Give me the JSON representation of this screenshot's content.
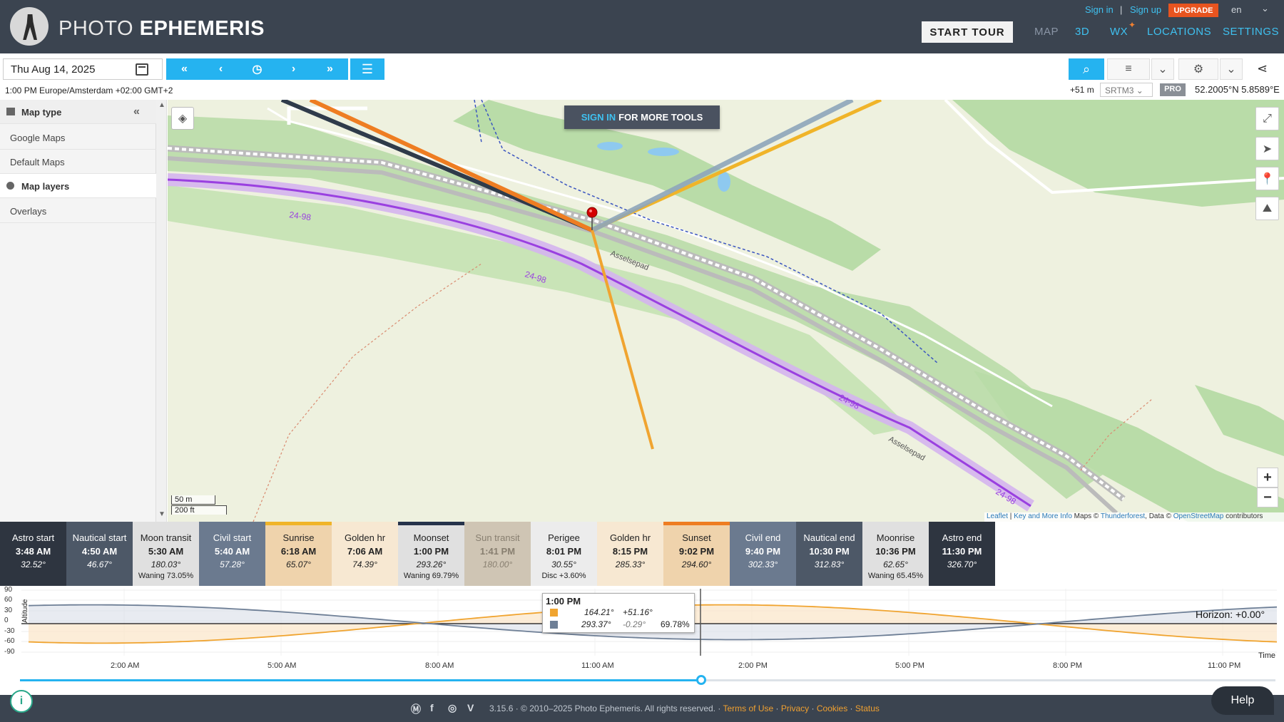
{
  "header": {
    "brand_light": "PHOTO",
    "brand_bold": "EPHEMERIS",
    "start_tour": "START TOUR",
    "nav": {
      "map": "MAP",
      "three_d": "3D",
      "wx": "WX",
      "locations": "LOCATIONS",
      "settings": "SETTINGS"
    },
    "sign_in": "Sign in",
    "separator": "|",
    "sign_up": "Sign up",
    "upgrade": "UPGRADE",
    "language": "en"
  },
  "toolbar": {
    "date": "Thu Aug 14, 2025",
    "timezone": "1:00 PM Europe/Amsterdam +02:00 GMT+2",
    "elevation": "+51 m",
    "dem": "SRTM3",
    "pro_badge": "PRO",
    "coordinates": "52.2005°N 5.8589°E"
  },
  "sidebar": {
    "map_type": "Map type",
    "items": [
      "Google Maps",
      "Default Maps"
    ],
    "map_layers": "Map layers",
    "overlays": "Overlays"
  },
  "map": {
    "signin_highlight": "SIGN IN",
    "signin_rest": "FOR MORE TOOLS",
    "scale_m": "50 m",
    "scale_ft": "200 ft",
    "labels": {
      "road": "Asselsepad",
      "route": "24-98"
    },
    "attribution": {
      "leaflet": "Leaflet",
      "key": "Key and More Info",
      "maps": " Maps © ",
      "thunderforest": "Thunderforest",
      "data": ", Data © ",
      "osm": "OpenStreetMap",
      "contrib": " contributors",
      "sep": " | "
    }
  },
  "events": [
    {
      "name": "Astro start",
      "time": "3:48 AM",
      "deg": "32.52°",
      "extra": "",
      "style": "night"
    },
    {
      "name": "Nautical start",
      "time": "4:50 AM",
      "deg": "46.67°",
      "extra": "",
      "style": "naut"
    },
    {
      "name": "Moon transit",
      "time": "5:30 AM",
      "deg": "180.03°",
      "extra": "Waning 73.05%",
      "style": "moon"
    },
    {
      "name": "Civil start",
      "time": "5:40 AM",
      "deg": "57.28°",
      "extra": "",
      "style": "civil"
    },
    {
      "name": "Sunrise",
      "time": "6:18 AM",
      "deg": "65.07°",
      "extra": "",
      "style": "sun top-yellow"
    },
    {
      "name": "Golden hr",
      "time": "7:06 AM",
      "deg": "74.39°",
      "extra": "",
      "style": "gold"
    },
    {
      "name": "Moonset",
      "time": "1:00 PM",
      "deg": "293.26°",
      "extra": "Waning 69.79%",
      "style": "moon top-dark"
    },
    {
      "name": "Sun transit",
      "time": "1:41 PM",
      "deg": "180.00°",
      "extra": "",
      "style": "transit"
    },
    {
      "name": "Perigee",
      "time": "8:01 PM",
      "deg": "30.55°",
      "extra": "Disc +3.60%",
      "style": "peri"
    },
    {
      "name": "Golden hr",
      "time": "8:15 PM",
      "deg": "285.33°",
      "extra": "",
      "style": "gold"
    },
    {
      "name": "Sunset",
      "time": "9:02 PM",
      "deg": "294.60°",
      "extra": "",
      "style": "sun top-orange"
    },
    {
      "name": "Civil end",
      "time": "9:40 PM",
      "deg": "302.33°",
      "extra": "",
      "style": "civil"
    },
    {
      "name": "Nautical end",
      "time": "10:30 PM",
      "deg": "312.83°",
      "extra": "",
      "style": "naut"
    },
    {
      "name": "Moonrise",
      "time": "10:36 PM",
      "deg": "62.65°",
      "extra": "Waning 65.45%",
      "style": "moon"
    },
    {
      "name": "Astro end",
      "time": "11:30 PM",
      "deg": "326.70°",
      "extra": "",
      "style": "night"
    }
  ],
  "chart": {
    "y_label": "Altitude",
    "y_ticks": [
      "90",
      "60",
      "30",
      "0",
      "-30",
      "-60",
      "-90"
    ],
    "x_ticks": [
      "2:00 AM",
      "5:00 AM",
      "8:00 AM",
      "11:00 AM",
      "2:00 PM",
      "5:00 PM",
      "8:00 PM",
      "11:00 PM"
    ],
    "time_label": "Time",
    "horizon": "Horizon: +0.00°",
    "tooltip": {
      "time": "1:00 PM",
      "sun_az": "164.21°",
      "sun_alt": "+51.16°",
      "moon_az": "293.37°",
      "moon_alt": "-0.29°",
      "moon_illum": "69.78%"
    },
    "colors": {
      "sun": "#f0a430",
      "moon": "#6e7f96"
    }
  },
  "footer": {
    "copyright": "3.15.6 · © 2010–2025 Photo Ephemeris. All rights reserved. · ",
    "terms": "Terms of Use",
    "dot1": " · ",
    "privacy": "Privacy",
    "dot2": " · ",
    "cookies": "Cookies",
    "dot3": " · ",
    "status": "Status",
    "help": "Help"
  }
}
